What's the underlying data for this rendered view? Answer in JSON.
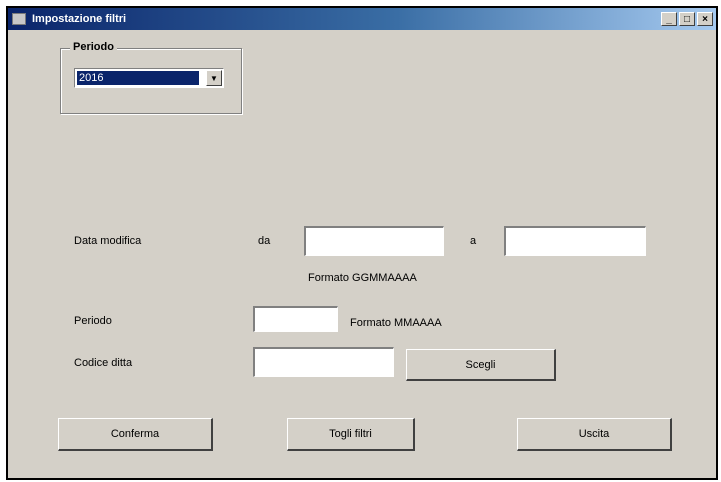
{
  "window": {
    "title": "Impostazione filtri",
    "minimize_glyph": "_",
    "maximize_glyph": "□",
    "close_glyph": "×"
  },
  "periodo_group": {
    "legend": "Periodo",
    "selected_value": "2016"
  },
  "data_modifica": {
    "label": "Data modifica",
    "from_label": "da",
    "to_label": "a",
    "from_value": "",
    "to_value": "",
    "format_hint": "Formato GGMMAAAA"
  },
  "periodo_field": {
    "label": "Periodo",
    "value": "",
    "format_hint": "Formato MMAAAA"
  },
  "codice_ditta": {
    "label": "Codice ditta",
    "value": "",
    "choose_button": "Scegli"
  },
  "actions": {
    "confirm": "Conferma",
    "remove_filters": "Togli filtri",
    "exit": "Uscita"
  }
}
